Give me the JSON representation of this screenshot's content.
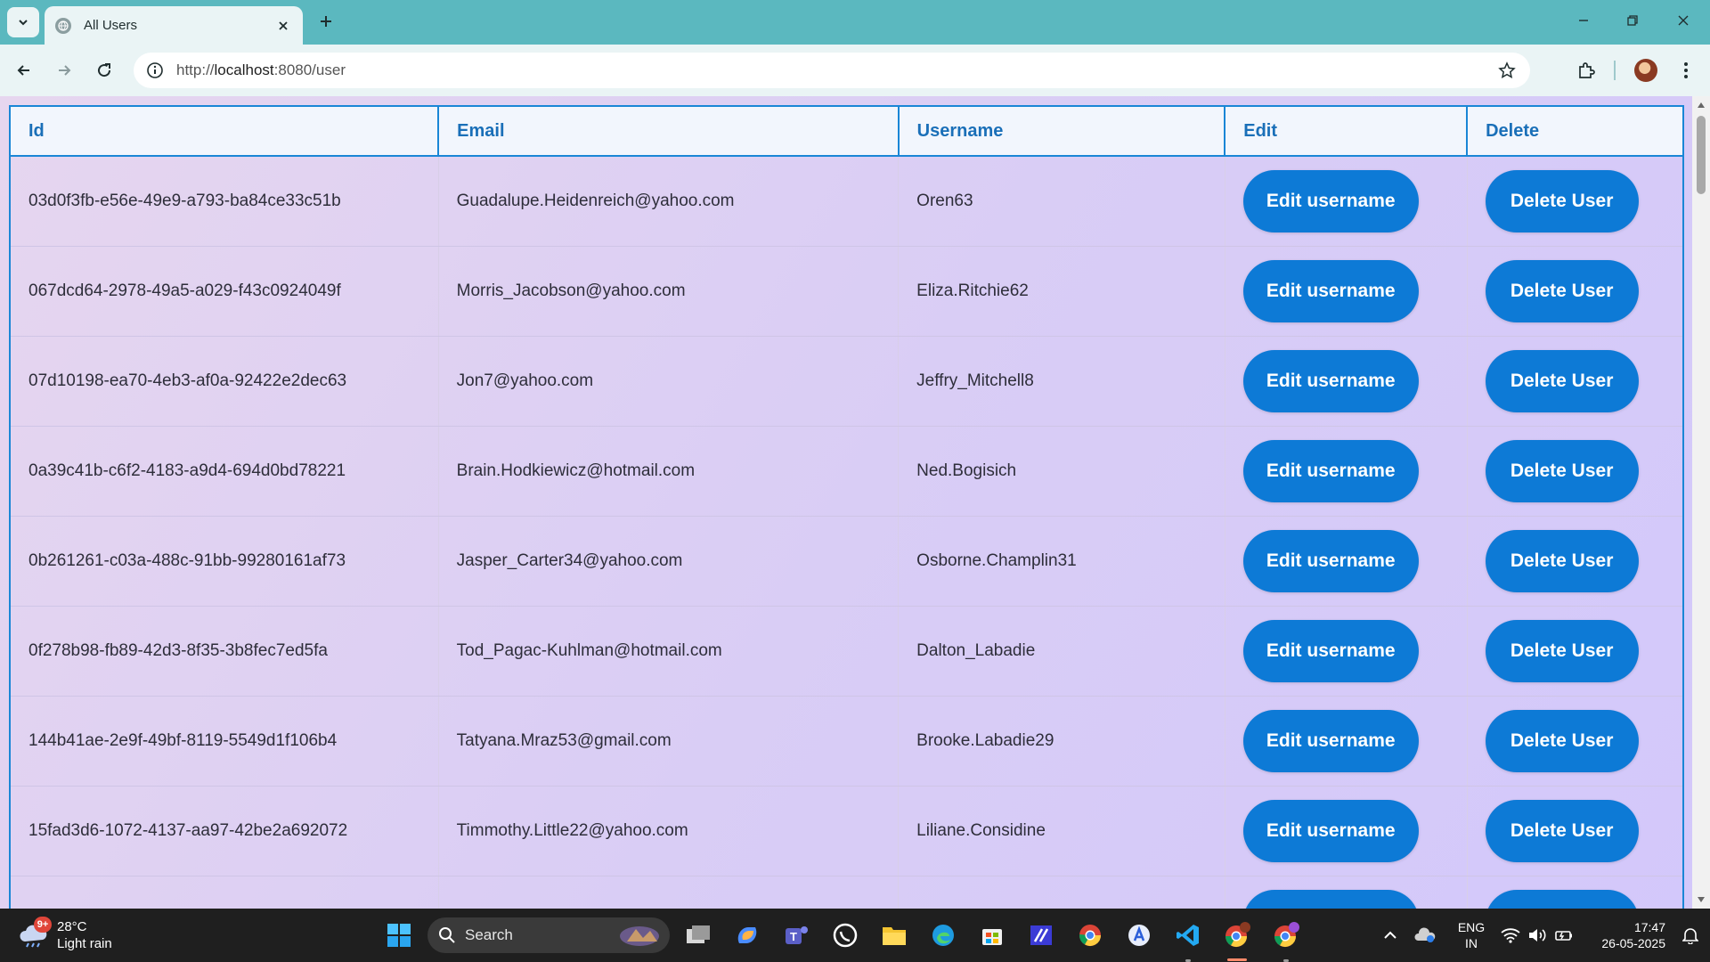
{
  "browser": {
    "tab_title": "All Users",
    "url_prefix": "http://",
    "url_host": "localhost",
    "url_rest": ":8080/user"
  },
  "table": {
    "headers": [
      "Id",
      "Email",
      "Username",
      "Edit",
      "Delete"
    ],
    "edit_label": "Edit username",
    "delete_label": "Delete User",
    "rows": [
      {
        "id": "03d0f3fb-e56e-49e9-a793-ba84ce33c51b",
        "email": "Guadalupe.Heidenreich@yahoo.com",
        "username": "Oren63"
      },
      {
        "id": "067dcd64-2978-49a5-a029-f43c0924049f",
        "email": "Morris_Jacobson@yahoo.com",
        "username": "Eliza.Ritchie62"
      },
      {
        "id": "07d10198-ea70-4eb3-af0a-92422e2dec63",
        "email": "Jon7@yahoo.com",
        "username": "Jeffry_Mitchell8"
      },
      {
        "id": "0a39c41b-c6f2-4183-a9d4-694d0bd78221",
        "email": "Brain.Hodkiewicz@hotmail.com",
        "username": "Ned.Bogisich"
      },
      {
        "id": "0b261261-c03a-488c-91bb-99280161af73",
        "email": "Jasper_Carter34@yahoo.com",
        "username": "Osborne.Champlin31"
      },
      {
        "id": "0f278b98-fb89-42d3-8f35-3b8fec7ed5fa",
        "email": "Tod_Pagac-Kuhlman@hotmail.com",
        "username": "Dalton_Labadie"
      },
      {
        "id": "144b41ae-2e9f-49bf-8119-5549d1f106b4",
        "email": "Tatyana.Mraz53@gmail.com",
        "username": "Brooke.Labadie29"
      },
      {
        "id": "15fad3d6-1072-4137-aa97-42be2a692072",
        "email": "Timmothy.Little22@yahoo.com",
        "username": "Liliane.Considine"
      },
      {
        "id": "",
        "email": "",
        "username": ""
      }
    ]
  },
  "taskbar": {
    "weather_badge": "9+",
    "temperature": "28°C",
    "condition": "Light rain",
    "search_label": "Search",
    "language": "ENG",
    "region": "IN",
    "time": "17:47",
    "date": "26-05-2025"
  },
  "colors": {
    "accent": "#0d7ad6",
    "header_text": "#1a6fb8",
    "table_border": "#1a86d6",
    "chrome": "#5bb8bf"
  }
}
